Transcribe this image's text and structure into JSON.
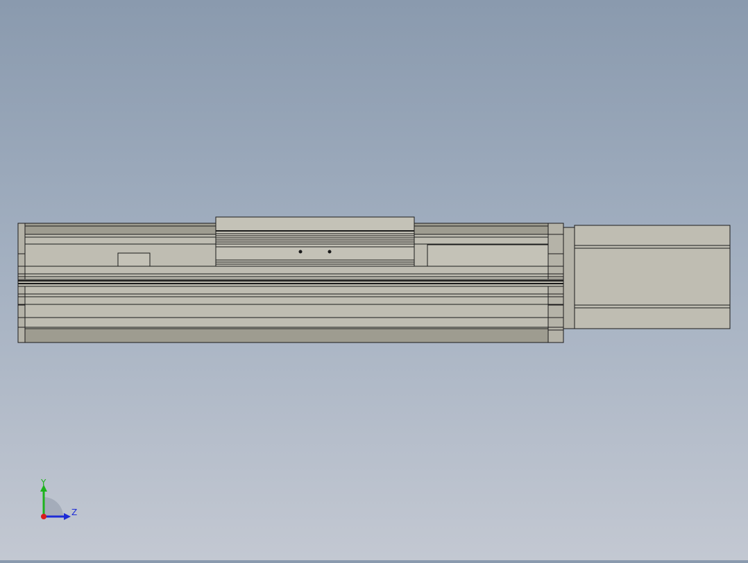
{
  "viewport": {
    "background_top": "#8a9aae",
    "background_bottom": "#c3c8d2",
    "part_fill": "#bfbdb2",
    "part_shadow": "#9e9c90",
    "edge_color": "#1a1a1a"
  },
  "triad": {
    "y_label": "Y",
    "z_label": "Z",
    "y_color": "#1db31d",
    "z_color": "#1d2bd6",
    "x_color": "#d81c1c"
  }
}
